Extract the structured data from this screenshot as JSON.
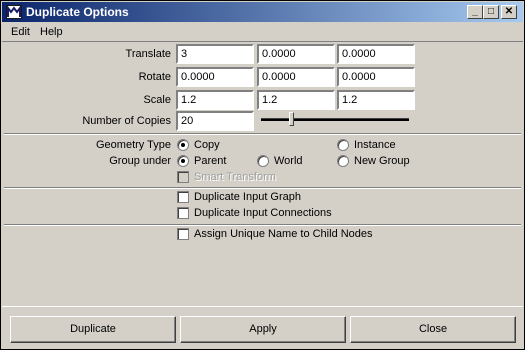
{
  "window": {
    "title": "Duplicate Options"
  },
  "title_buttons": {
    "minimize": "_",
    "maximize": "□",
    "close": "✕"
  },
  "menu": [
    "Edit",
    "Help"
  ],
  "transform": {
    "translate": {
      "label": "Translate",
      "values": [
        "3",
        "0.0000",
        "0.0000"
      ]
    },
    "rotate": {
      "label": "Rotate",
      "values": [
        "0.0000",
        "0.0000",
        "0.0000"
      ]
    },
    "scale": {
      "label": "Scale",
      "values": [
        "1.2",
        "1.2",
        "1.2"
      ]
    },
    "copies": {
      "label": "Number of Copies",
      "value": "20"
    }
  },
  "geometry_type": {
    "label": "Geometry Type",
    "options": [
      "Copy",
      "Instance"
    ],
    "selected": "Copy"
  },
  "group_under": {
    "label": "Group under",
    "options": [
      "Parent",
      "World",
      "New Group"
    ],
    "selected": "Parent"
  },
  "smart_transform": {
    "label": "Smart Transform",
    "checked": false,
    "enabled": false
  },
  "duplicate_input_graph": {
    "label": "Duplicate Input Graph",
    "checked": false
  },
  "duplicate_input_connections": {
    "label": "Duplicate Input Connections",
    "checked": false
  },
  "assign_unique_name": {
    "label": "Assign Unique Name to Child Nodes",
    "checked": false
  },
  "buttons": {
    "duplicate": "Duplicate",
    "apply": "Apply",
    "close": "Close"
  }
}
